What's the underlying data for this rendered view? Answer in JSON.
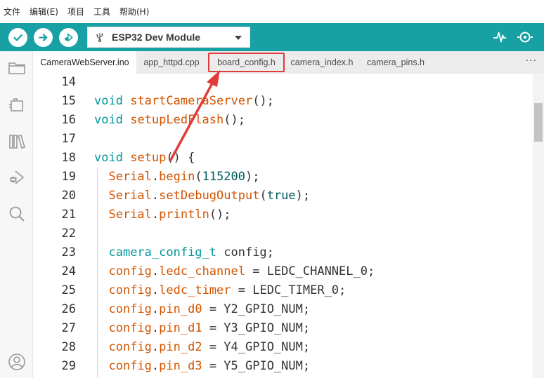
{
  "menu": [
    "文件",
    "编辑(E)",
    "项目",
    "工具",
    "帮助(H)"
  ],
  "toolbar": {
    "board_name": "ESP32 Dev Module",
    "accent": "#17a1a5"
  },
  "tabs": [
    {
      "label": "CameraWebServer.ino",
      "active": true
    },
    {
      "label": "app_httpd.cpp",
      "active": false
    },
    {
      "label": "board_config.h",
      "active": false,
      "highlighted": true
    },
    {
      "label": "camera_index.h",
      "active": false
    },
    {
      "label": "camera_pins.h",
      "active": false
    }
  ],
  "tabs_more": "···",
  "annotation_color": "#e23b3b",
  "lines": [
    {
      "n": "14",
      "code": ""
    },
    {
      "n": "15",
      "code": "void startCameraServer();"
    },
    {
      "n": "16",
      "code": "void setupLedFlash();"
    },
    {
      "n": "17",
      "code": ""
    },
    {
      "n": "18",
      "code": "void setup() {"
    },
    {
      "n": "19",
      "code": "  Serial.begin(115200);"
    },
    {
      "n": "20",
      "code": "  Serial.setDebugOutput(true);"
    },
    {
      "n": "21",
      "code": "  Serial.println();"
    },
    {
      "n": "22",
      "code": ""
    },
    {
      "n": "23",
      "code": "  camera_config_t config;"
    },
    {
      "n": "24",
      "code": "  config.ledc_channel = LEDC_CHANNEL_0;"
    },
    {
      "n": "25",
      "code": "  config.ledc_timer = LEDC_TIMER_0;"
    },
    {
      "n": "26",
      "code": "  config.pin_d0 = Y2_GPIO_NUM;"
    },
    {
      "n": "27",
      "code": "  config.pin_d1 = Y3_GPIO_NUM;"
    },
    {
      "n": "28",
      "code": "  config.pin_d2 = Y4_GPIO_NUM;"
    },
    {
      "n": "29",
      "code": "  config.pin_d3 = Y5_GPIO_NUM;"
    }
  ]
}
